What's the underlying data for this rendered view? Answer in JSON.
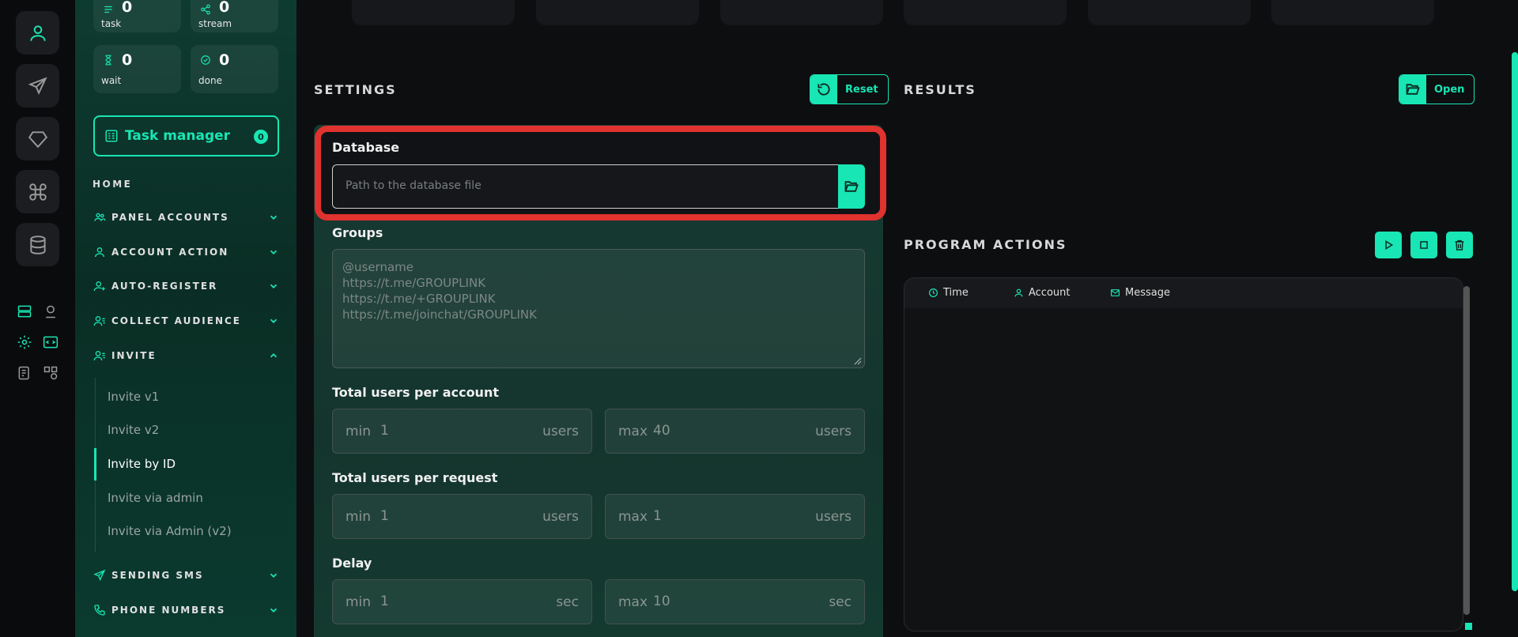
{
  "colors": {
    "accent": "#18e6b4",
    "highlight": "#e0322e"
  },
  "rail": {
    "icons": [
      "user-icon",
      "send-icon",
      "diamond-icon",
      "command-icon",
      "database-icon"
    ],
    "small_icons": [
      "server-icon",
      "user-pin-icon",
      "gear-icon",
      "code-icon",
      "checklist-icon",
      "shapes-icon"
    ]
  },
  "sidebar": {
    "stats": [
      {
        "value": "0",
        "label": "task",
        "icon": "tasks-icon"
      },
      {
        "value": "0",
        "label": "stream",
        "icon": "share-icon"
      },
      {
        "value": "0",
        "label": "wait",
        "icon": "hourglass-icon"
      },
      {
        "value": "0",
        "label": "done",
        "icon": "check-circle-icon"
      }
    ],
    "task_manager": {
      "label": "Task manager",
      "badge": "0"
    },
    "home": "HOME",
    "nav": [
      {
        "label": "PANEL ACCOUNTS",
        "icon": "users-icon"
      },
      {
        "label": "ACCOUNT ACTION",
        "icon": "user-icon"
      },
      {
        "label": "AUTO-REGISTER",
        "icon": "user-plus-icon"
      },
      {
        "label": "COLLECT AUDIENCE",
        "icon": "user-list-icon"
      },
      {
        "label": "INVITE",
        "icon": "user-list-icon"
      },
      {
        "label": "SENDING SMS",
        "icon": "send-icon"
      },
      {
        "label": "PHONE NUMBERS",
        "icon": "phone-icon"
      }
    ],
    "invite_sub": [
      "Invite v1",
      "Invite v2",
      "Invite by ID",
      "Invite via admin",
      "Invite via Admin (v2)"
    ]
  },
  "settings": {
    "title": "SETTINGS",
    "reset_label": "Reset",
    "database": {
      "label": "Database",
      "placeholder": "Path to the database file"
    },
    "groups": {
      "label": "Groups",
      "placeholder_lines": [
        "@username",
        "https://t.me/GROUPLINK",
        "https://t.me/+GROUPLINK",
        "https://t.me/joinchat/GROUPLINK"
      ]
    },
    "users_per_account": {
      "label": "Total users per account",
      "min": "1",
      "max": "40",
      "unit": "users"
    },
    "users_per_request": {
      "label": "Total users per request",
      "min": "1",
      "max": "1",
      "unit": "users"
    },
    "delay": {
      "label": "Delay",
      "min": "1",
      "max": "10",
      "unit": "sec"
    },
    "min_prefix": "min",
    "max_prefix": "max"
  },
  "results": {
    "title": "RESULTS",
    "open_label": "Open"
  },
  "program_actions": {
    "title": "PROGRAM ACTIONS",
    "columns": [
      "Time",
      "Account",
      "Message"
    ]
  }
}
